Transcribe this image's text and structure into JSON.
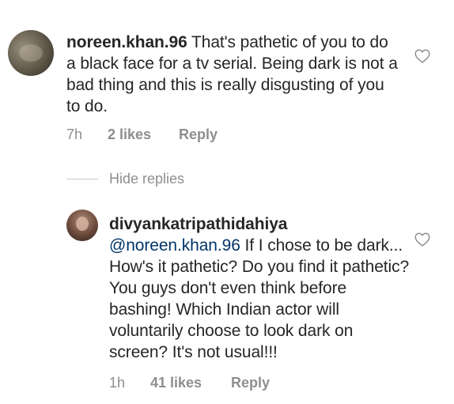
{
  "comments": [
    {
      "username": "noreen.khan.96",
      "text": "That's pathetic of you to do a black face for a tv serial. Being dark is not a bad thing and this is really disgusting of you to do.",
      "time": "7h",
      "likes": "2 likes",
      "reply_label": "Reply",
      "like_icon": "heart-outline-icon"
    }
  ],
  "hide_replies_label": "Hide replies",
  "replies": [
    {
      "username": "divyankatripathidahiya",
      "mention": "@noreen.khan.96",
      "text": "If I chose to be dark... How's it pathetic? Do you find it pathetic? You guys don't even think before bashing! Which Indian actor will voluntarily choose to look dark on screen? It's not usual!!!",
      "time": "1h",
      "likes": "41 likes",
      "reply_label": "Reply",
      "like_icon": "heart-outline-icon"
    }
  ],
  "colors": {
    "text": "#262626",
    "meta": "#8e8e8e",
    "mention": "#003569"
  }
}
